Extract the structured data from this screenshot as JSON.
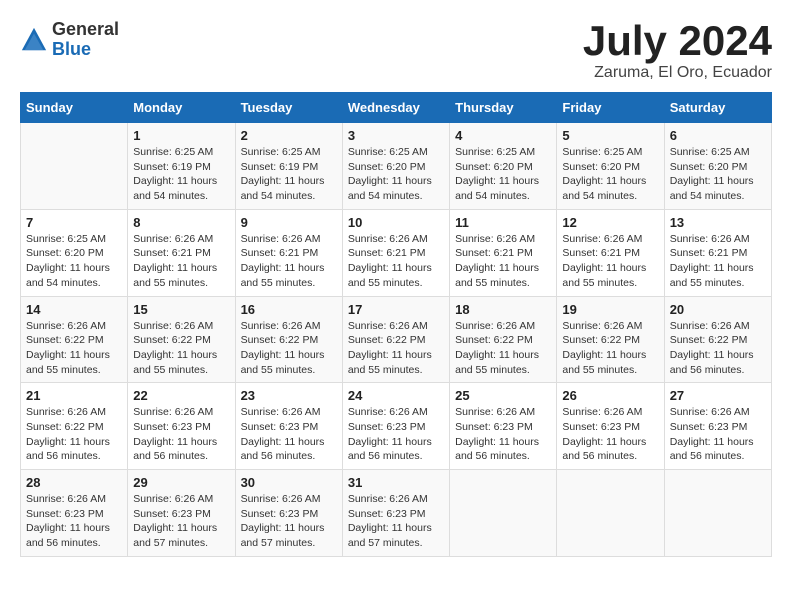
{
  "logo": {
    "general": "General",
    "blue": "Blue"
  },
  "title": "July 2024",
  "location": "Zaruma, El Oro, Ecuador",
  "weekdays": [
    "Sunday",
    "Monday",
    "Tuesday",
    "Wednesday",
    "Thursday",
    "Friday",
    "Saturday"
  ],
  "weeks": [
    [
      {
        "day": "",
        "sunrise": "",
        "sunset": "",
        "daylight": ""
      },
      {
        "day": "1",
        "sunrise": "Sunrise: 6:25 AM",
        "sunset": "Sunset: 6:19 PM",
        "daylight": "Daylight: 11 hours and 54 minutes."
      },
      {
        "day": "2",
        "sunrise": "Sunrise: 6:25 AM",
        "sunset": "Sunset: 6:19 PM",
        "daylight": "Daylight: 11 hours and 54 minutes."
      },
      {
        "day": "3",
        "sunrise": "Sunrise: 6:25 AM",
        "sunset": "Sunset: 6:20 PM",
        "daylight": "Daylight: 11 hours and 54 minutes."
      },
      {
        "day": "4",
        "sunrise": "Sunrise: 6:25 AM",
        "sunset": "Sunset: 6:20 PM",
        "daylight": "Daylight: 11 hours and 54 minutes."
      },
      {
        "day": "5",
        "sunrise": "Sunrise: 6:25 AM",
        "sunset": "Sunset: 6:20 PM",
        "daylight": "Daylight: 11 hours and 54 minutes."
      },
      {
        "day": "6",
        "sunrise": "Sunrise: 6:25 AM",
        "sunset": "Sunset: 6:20 PM",
        "daylight": "Daylight: 11 hours and 54 minutes."
      }
    ],
    [
      {
        "day": "7",
        "sunrise": "Sunrise: 6:25 AM",
        "sunset": "Sunset: 6:20 PM",
        "daylight": "Daylight: 11 hours and 54 minutes."
      },
      {
        "day": "8",
        "sunrise": "Sunrise: 6:26 AM",
        "sunset": "Sunset: 6:21 PM",
        "daylight": "Daylight: 11 hours and 55 minutes."
      },
      {
        "day": "9",
        "sunrise": "Sunrise: 6:26 AM",
        "sunset": "Sunset: 6:21 PM",
        "daylight": "Daylight: 11 hours and 55 minutes."
      },
      {
        "day": "10",
        "sunrise": "Sunrise: 6:26 AM",
        "sunset": "Sunset: 6:21 PM",
        "daylight": "Daylight: 11 hours and 55 minutes."
      },
      {
        "day": "11",
        "sunrise": "Sunrise: 6:26 AM",
        "sunset": "Sunset: 6:21 PM",
        "daylight": "Daylight: 11 hours and 55 minutes."
      },
      {
        "day": "12",
        "sunrise": "Sunrise: 6:26 AM",
        "sunset": "Sunset: 6:21 PM",
        "daylight": "Daylight: 11 hours and 55 minutes."
      },
      {
        "day": "13",
        "sunrise": "Sunrise: 6:26 AM",
        "sunset": "Sunset: 6:21 PM",
        "daylight": "Daylight: 11 hours and 55 minutes."
      }
    ],
    [
      {
        "day": "14",
        "sunrise": "Sunrise: 6:26 AM",
        "sunset": "Sunset: 6:22 PM",
        "daylight": "Daylight: 11 hours and 55 minutes."
      },
      {
        "day": "15",
        "sunrise": "Sunrise: 6:26 AM",
        "sunset": "Sunset: 6:22 PM",
        "daylight": "Daylight: 11 hours and 55 minutes."
      },
      {
        "day": "16",
        "sunrise": "Sunrise: 6:26 AM",
        "sunset": "Sunset: 6:22 PM",
        "daylight": "Daylight: 11 hours and 55 minutes."
      },
      {
        "day": "17",
        "sunrise": "Sunrise: 6:26 AM",
        "sunset": "Sunset: 6:22 PM",
        "daylight": "Daylight: 11 hours and 55 minutes."
      },
      {
        "day": "18",
        "sunrise": "Sunrise: 6:26 AM",
        "sunset": "Sunset: 6:22 PM",
        "daylight": "Daylight: 11 hours and 55 minutes."
      },
      {
        "day": "19",
        "sunrise": "Sunrise: 6:26 AM",
        "sunset": "Sunset: 6:22 PM",
        "daylight": "Daylight: 11 hours and 55 minutes."
      },
      {
        "day": "20",
        "sunrise": "Sunrise: 6:26 AM",
        "sunset": "Sunset: 6:22 PM",
        "daylight": "Daylight: 11 hours and 56 minutes."
      }
    ],
    [
      {
        "day": "21",
        "sunrise": "Sunrise: 6:26 AM",
        "sunset": "Sunset: 6:22 PM",
        "daylight": "Daylight: 11 hours and 56 minutes."
      },
      {
        "day": "22",
        "sunrise": "Sunrise: 6:26 AM",
        "sunset": "Sunset: 6:23 PM",
        "daylight": "Daylight: 11 hours and 56 minutes."
      },
      {
        "day": "23",
        "sunrise": "Sunrise: 6:26 AM",
        "sunset": "Sunset: 6:23 PM",
        "daylight": "Daylight: 11 hours and 56 minutes."
      },
      {
        "day": "24",
        "sunrise": "Sunrise: 6:26 AM",
        "sunset": "Sunset: 6:23 PM",
        "daylight": "Daylight: 11 hours and 56 minutes."
      },
      {
        "day": "25",
        "sunrise": "Sunrise: 6:26 AM",
        "sunset": "Sunset: 6:23 PM",
        "daylight": "Daylight: 11 hours and 56 minutes."
      },
      {
        "day": "26",
        "sunrise": "Sunrise: 6:26 AM",
        "sunset": "Sunset: 6:23 PM",
        "daylight": "Daylight: 11 hours and 56 minutes."
      },
      {
        "day": "27",
        "sunrise": "Sunrise: 6:26 AM",
        "sunset": "Sunset: 6:23 PM",
        "daylight": "Daylight: 11 hours and 56 minutes."
      }
    ],
    [
      {
        "day": "28",
        "sunrise": "Sunrise: 6:26 AM",
        "sunset": "Sunset: 6:23 PM",
        "daylight": "Daylight: 11 hours and 56 minutes."
      },
      {
        "day": "29",
        "sunrise": "Sunrise: 6:26 AM",
        "sunset": "Sunset: 6:23 PM",
        "daylight": "Daylight: 11 hours and 57 minutes."
      },
      {
        "day": "30",
        "sunrise": "Sunrise: 6:26 AM",
        "sunset": "Sunset: 6:23 PM",
        "daylight": "Daylight: 11 hours and 57 minutes."
      },
      {
        "day": "31",
        "sunrise": "Sunrise: 6:26 AM",
        "sunset": "Sunset: 6:23 PM",
        "daylight": "Daylight: 11 hours and 57 minutes."
      },
      {
        "day": "",
        "sunrise": "",
        "sunset": "",
        "daylight": ""
      },
      {
        "day": "",
        "sunrise": "",
        "sunset": "",
        "daylight": ""
      },
      {
        "day": "",
        "sunrise": "",
        "sunset": "",
        "daylight": ""
      }
    ]
  ]
}
